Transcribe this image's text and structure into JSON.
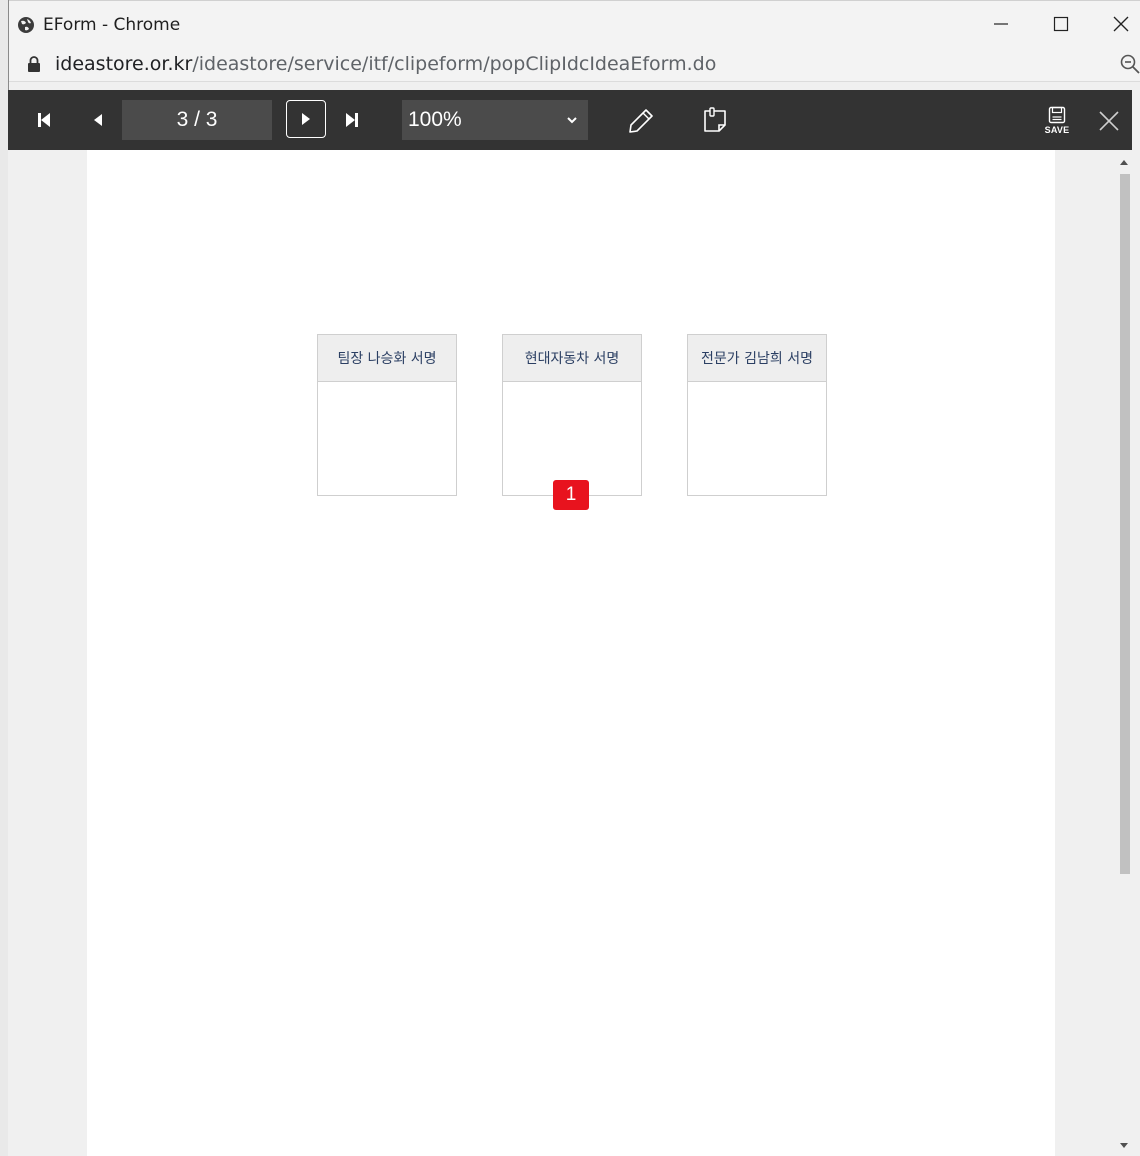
{
  "window": {
    "title": "EForm - Chrome"
  },
  "address_bar": {
    "host": "ideastore.or.kr",
    "path": "/ideastore/service/itf/clipeform/popClipIdcIdeaEform.do"
  },
  "toolbar": {
    "page_indicator": "3 / 3",
    "zoom_level": "100%",
    "save_label": "SAVE"
  },
  "document": {
    "signature_boxes": [
      {
        "label": "팀장 나승화 서명"
      },
      {
        "label": "현대자동차 서명"
      },
      {
        "label": "전문가 김남희 서명"
      }
    ],
    "marker_label": "1"
  },
  "colors": {
    "toolbar_bg": "#333333",
    "marker": "#e8131e",
    "sig_header_text": "#2b3f63"
  }
}
